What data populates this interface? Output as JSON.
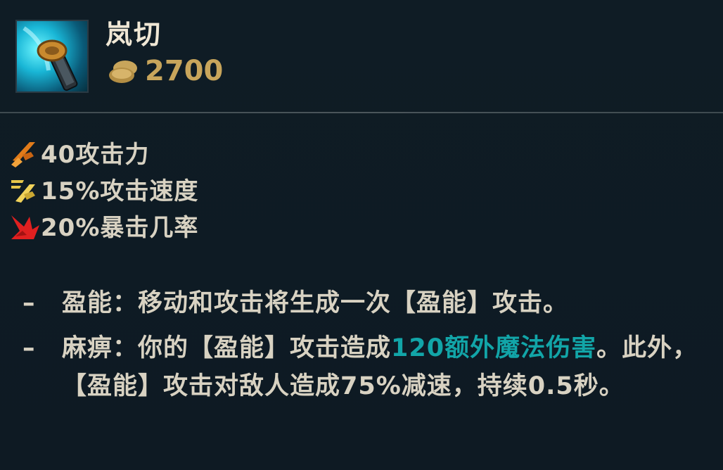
{
  "item": {
    "name": "岚切",
    "gold": "2700"
  },
  "stats": [
    {
      "icon": "attack-damage-icon",
      "text": "40攻击力"
    },
    {
      "icon": "attack-speed-icon",
      "text": "15%攻击速度"
    },
    {
      "icon": "critical-strike-icon",
      "text": "20%暴击几率"
    }
  ],
  "passives": [
    {
      "bullet": "–",
      "label": "盈能：",
      "text": "移动和攻击将生成一次【盈能】攻击。"
    },
    {
      "bullet": "–",
      "label": "麻痹：",
      "text_before": "你的【盈能】攻击造成",
      "highlight": "120额外魔法伤害",
      "text_after": "。此外，【盈能】攻击对敌人造成75%减速，持续0.5秒。"
    }
  ],
  "colors": {
    "background": "#0e1a23",
    "text": "#d8d2c2",
    "gold": "#c8a55b",
    "highlight": "#12a5a8"
  }
}
